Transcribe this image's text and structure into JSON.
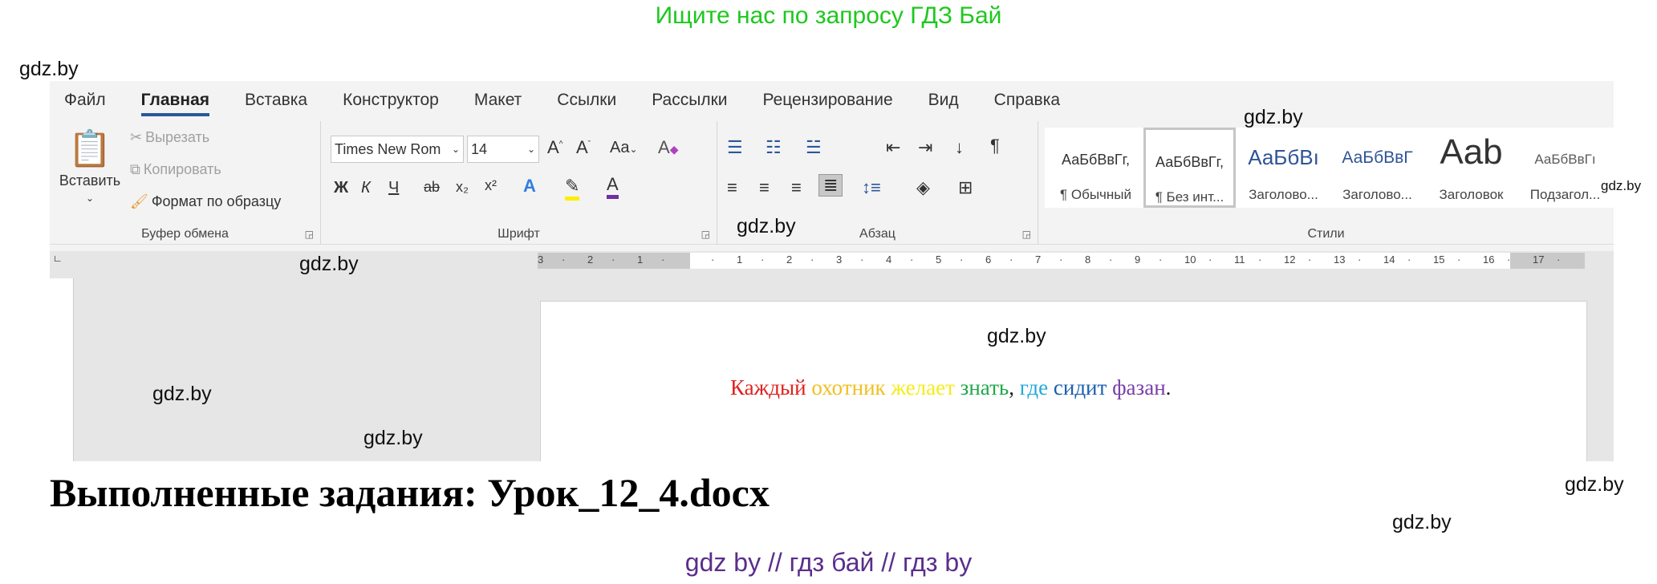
{
  "promo": "Ищите нас по запросу ГДЗ Бай",
  "watermark": "gdz.by",
  "tabs": [
    "Файл",
    "Главная",
    "Вставка",
    "Конструктор",
    "Макет",
    "Ссылки",
    "Рассылки",
    "Рецензирование",
    "Вид",
    "Справка"
  ],
  "active_tab": "Главная",
  "clipboard": {
    "paste": "Вставить",
    "cut": "Вырезать",
    "copy": "Копировать",
    "format_painter": "Формат по образцу",
    "label": "Буфер обмена"
  },
  "font": {
    "name": "Times New Rom",
    "size": "14",
    "case": "Aa",
    "bold": "Ж",
    "italic": "К",
    "underline": "Ч",
    "strike": "ab",
    "sub": "x₂",
    "sup": "x²",
    "label": "Шрифт"
  },
  "paragraph": {
    "label": "Абзац",
    "pilcrow": "¶"
  },
  "styles": {
    "label": "Стили",
    "items": [
      {
        "preview": "АаБбВвГг,",
        "name": "¶ Обычный"
      },
      {
        "preview": "АаБбВвГг,",
        "name": "¶ Без инт..."
      },
      {
        "preview": "АаБбВı",
        "name": "Заголово..."
      },
      {
        "preview": "АаБбВвГ",
        "name": "Заголово..."
      },
      {
        "preview": "Aab",
        "name": "Заголовок"
      },
      {
        "preview": "АаБбВвГı",
        "name": "Подзагол..."
      }
    ]
  },
  "ruler": [
    "3",
    "2",
    "1",
    "",
    "1",
    "2",
    "3",
    "4",
    "5",
    "6",
    "7",
    "8",
    "9",
    "10",
    "11",
    "12",
    "13",
    "14",
    "15",
    "16",
    "17"
  ],
  "document": {
    "words": [
      {
        "text": "Каждый",
        "color": "#e0201e"
      },
      {
        "text": " охотник",
        "color": "#f0c020"
      },
      {
        "text": " желает",
        "color": "#f4ec1a"
      },
      {
        "text": " знать",
        "color": "#1fa84a"
      },
      {
        "text": ",",
        "color": "#222222"
      },
      {
        "text": " где",
        "color": "#21a9d8"
      },
      {
        "text": " сидит",
        "color": "#1c5fae"
      },
      {
        "text": " фазан",
        "color": "#7a3fa8"
      },
      {
        "text": ".",
        "color": "#222222"
      }
    ]
  },
  "heading": "Выполненные задания: Урок_12_4.docx",
  "footer": "gdz by  //  гдз бай  //  гдз by"
}
